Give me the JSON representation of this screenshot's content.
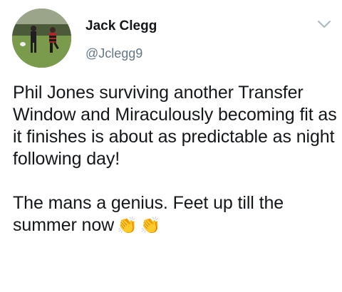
{
  "user": {
    "display_name": "Jack Clegg",
    "handle": "@Jclegg9"
  },
  "tweet": {
    "paragraph_1": "Phil Jones surviving another Transfer Window and Miraculously becoming fit as it finishes is about as predictable as night following day!",
    "paragraph_2": "The mans a genius. Feet up till the summer now",
    "emoji": [
      "👏",
      "👏"
    ]
  },
  "icons": {
    "avatar": "avatar-photo",
    "menu": "chevron-down-icon",
    "emoji": "clapping-hands-icon"
  },
  "colors": {
    "text": "#14171a",
    "secondary": "#657786",
    "chevron": "#aab8c2",
    "emoji": "#f5b90f"
  }
}
